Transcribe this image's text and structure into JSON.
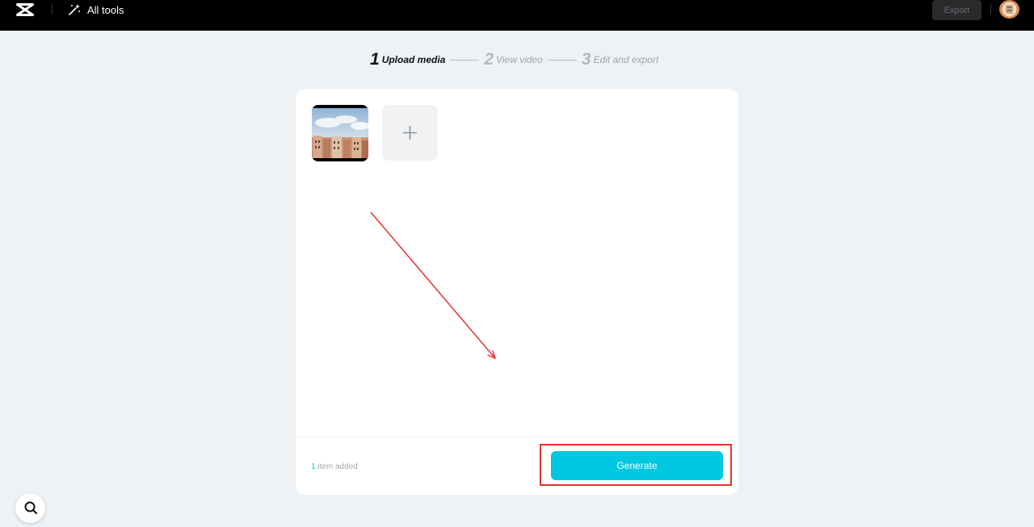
{
  "topbar": {
    "logo_icon": "capcut-logo-icon",
    "all_tools_icon": "magic-wand-icon",
    "all_tools_label": "All tools",
    "export_label": "Export",
    "avatar_icon": "user-avatar"
  },
  "steps": [
    {
      "number": "1",
      "label": "Upload media",
      "active": true
    },
    {
      "number": "2",
      "label": "View video",
      "active": false
    },
    {
      "number": "3",
      "label": "Edit and export",
      "active": false
    }
  ],
  "upload": {
    "media_count": 1,
    "add_icon": "plus-icon",
    "count_number": "1",
    "count_text": " item added",
    "generate_label": "Generate"
  },
  "colors": {
    "accent": "#00c8e0",
    "annotation": "#e5332f",
    "background": "#eef2f5"
  },
  "help_icon": "search-icon"
}
